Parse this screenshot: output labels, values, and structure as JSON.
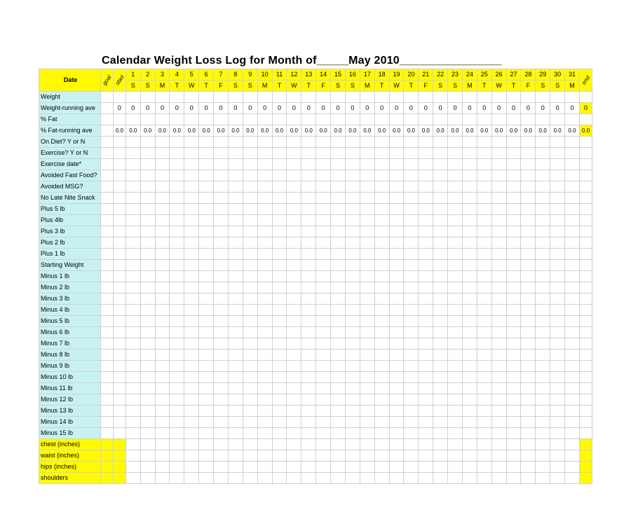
{
  "title": "Calendar Weight Loss Log for Month of_____May 2010________________",
  "header": {
    "date_label": "Date",
    "goal_label": "goal",
    "start_label": "start",
    "end_label": "end",
    "days": [
      "1",
      "2",
      "3",
      "4",
      "5",
      "6",
      "7",
      "8",
      "9",
      "10",
      "11",
      "12",
      "13",
      "14",
      "15",
      "16",
      "17",
      "18",
      "19",
      "20",
      "21",
      "22",
      "23",
      "24",
      "25",
      "26",
      "27",
      "28",
      "29",
      "30",
      "31"
    ],
    "dow": [
      "S",
      "S",
      "M",
      "T",
      "W",
      "T",
      "F",
      "S",
      "S",
      "M",
      "T",
      "W",
      "T",
      "F",
      "S",
      "S",
      "M",
      "T",
      "W",
      "T",
      "F",
      "S",
      "S",
      "M",
      "T",
      "W",
      "T",
      "F",
      "S",
      "S",
      "M"
    ]
  },
  "rows_top": [
    {
      "label": "Weight",
      "fill": "aqua"
    },
    {
      "label": "Weight-running ave",
      "fill": "aqua",
      "start": "0",
      "days_fill": "0",
      "end": "0",
      "end_yellow": true
    },
    {
      "label": "% Fat",
      "fill": "aqua"
    },
    {
      "label": "% Fat-running ave",
      "fill": "aqua",
      "start": "0.0",
      "days_fill": "0.0",
      "end": "0.0",
      "end_yellow": true,
      "small": true
    },
    {
      "label": "On Diet? Y or N",
      "fill": "aqua"
    },
    {
      "label": "Exercise? Y or N",
      "fill": "aqua"
    },
    {
      "label": "Exercise date*",
      "fill": "aqua"
    },
    {
      "label": "Avoided Fast Food?",
      "fill": "aqua"
    },
    {
      "label": "Avoided MSG?",
      "fill": "aqua"
    },
    {
      "label": "No Late Nite Snack",
      "fill": "aqua",
      "heavy_after": true
    }
  ],
  "rows_plus": [
    {
      "label": " Plus 5 lb",
      "fill": "aqua"
    },
    {
      "label": " Plus 4lb",
      "fill": "aqua"
    },
    {
      "label": " Plus 3 lb",
      "fill": "aqua"
    },
    {
      "label": " Plus 2 lb",
      "fill": "aqua"
    },
    {
      "label": " Plus 1 lb",
      "fill": "aqua"
    }
  ],
  "row_starting": {
    "label": "Starting Weight",
    "fill": "aqua"
  },
  "rows_minus": [
    {
      "label": "Minus 1 lb",
      "fill": "aqua"
    },
    {
      "label": "Minus 2 lb",
      "fill": "aqua"
    },
    {
      "label": "Minus 3 lb",
      "fill": "aqua"
    },
    {
      "label": "Minus 4 lb",
      "fill": "aqua"
    },
    {
      "label": "Minus 5 lb",
      "fill": "aqua",
      "heavy_after": true
    },
    {
      "label": "Minus 6 lb",
      "fill": "aqua"
    },
    {
      "label": "Minus 7 lb",
      "fill": "aqua"
    },
    {
      "label": "Minus 8 lb",
      "fill": "aqua"
    },
    {
      "label": "Minus 9 lb",
      "fill": "aqua"
    },
    {
      "label": "Minus 10 lb",
      "fill": "aqua"
    },
    {
      "label": "Minus 11 lb",
      "fill": "aqua"
    },
    {
      "label": "Minus 12 lb",
      "fill": "aqua"
    },
    {
      "label": "Minus 13 lb",
      "fill": "aqua"
    },
    {
      "label": "Minus 14 lb",
      "fill": "aqua"
    },
    {
      "label": "Minus 15 lb",
      "fill": "aqua"
    }
  ],
  "rows_meas": [
    {
      "label": "chest (inches)",
      "fill": "yellow",
      "goal_yellow": true,
      "start_yellow": true,
      "end_yellow": true
    },
    {
      "label": "waist (inches)",
      "fill": "yellow",
      "goal_yellow": true,
      "start_yellow": true,
      "end_yellow": true
    },
    {
      "label": "hips (inches)",
      "fill": "yellow",
      "goal_yellow": true,
      "start_yellow": true,
      "end_yellow": true
    },
    {
      "label": "shoulders",
      "fill": "yellow",
      "goal_yellow": true,
      "start_yellow": true,
      "end_yellow": true
    }
  ]
}
